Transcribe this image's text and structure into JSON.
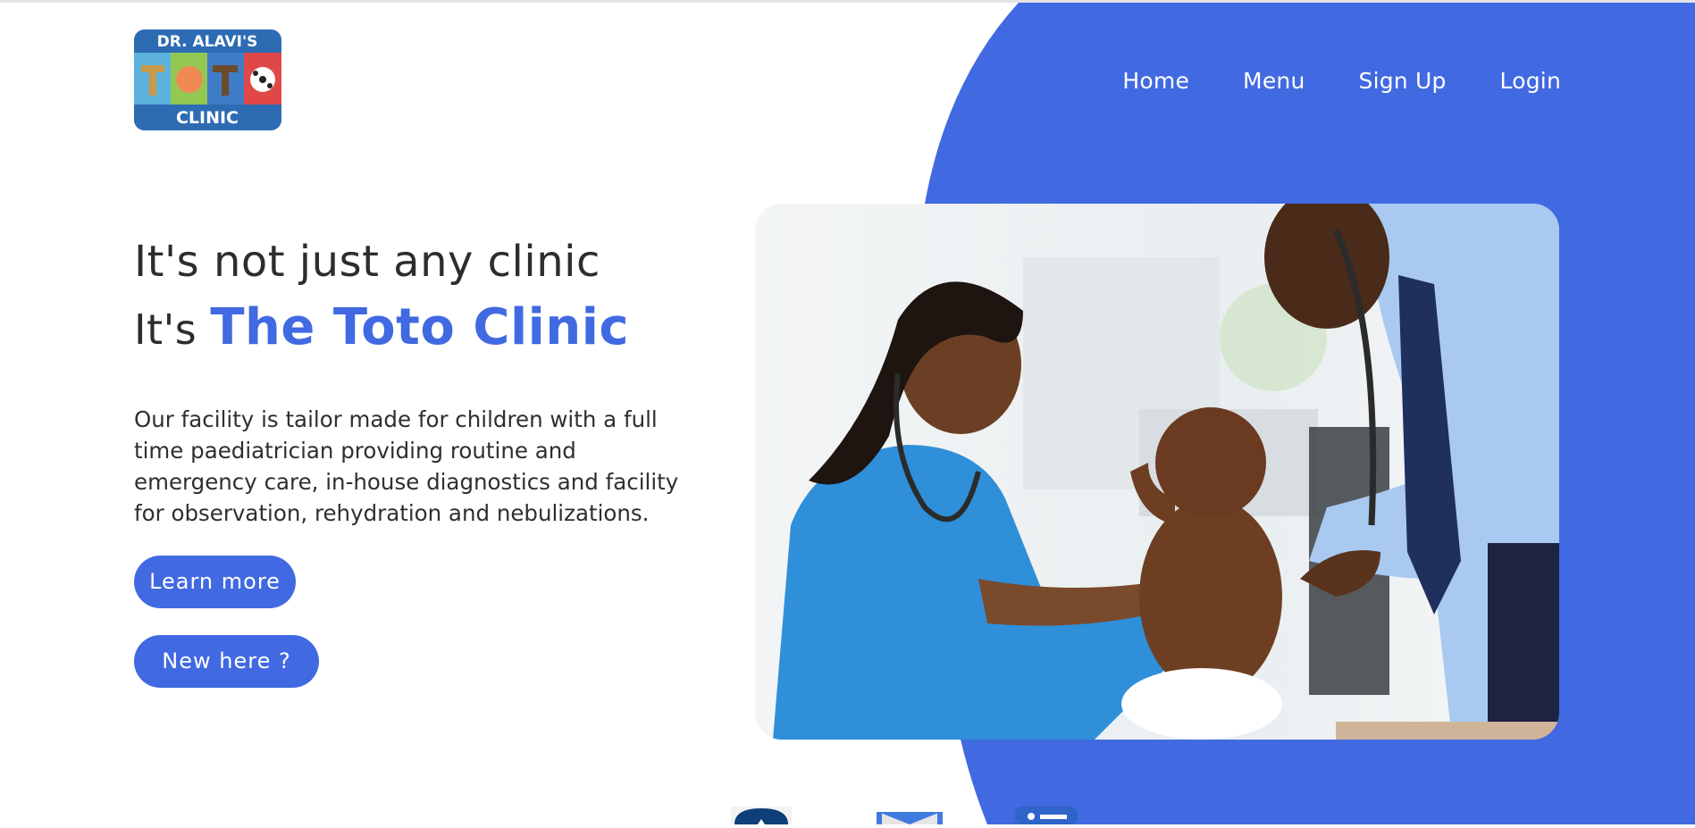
{
  "logo": {
    "top_text": "DR. ALAVI'S",
    "middle_text": "TOTO",
    "bottom_text": "CLINIC"
  },
  "nav": {
    "items": [
      "Home",
      "Menu",
      "Sign Up",
      "Login"
    ]
  },
  "hero": {
    "line1": "It's not just any clinic",
    "line2_prefix": "It's",
    "line2_brand": "The Toto Clinic",
    "description": "Our facility is tailor made for children with a full time paediatrician providing routine and emergency care, in-house diagnostics and facility for observation, rehydration and nebulizations.",
    "learn_more": "Learn more",
    "new_here": "New here ?"
  },
  "photo": {
    "icon": "doctors-examining-child-photo"
  },
  "social": {
    "icons": [
      "home-icon",
      "mail-icon",
      "chat-icon"
    ]
  },
  "colors": {
    "accent": "#4169e1",
    "dark_text": "#2d2d2d",
    "white": "#ffffff"
  }
}
